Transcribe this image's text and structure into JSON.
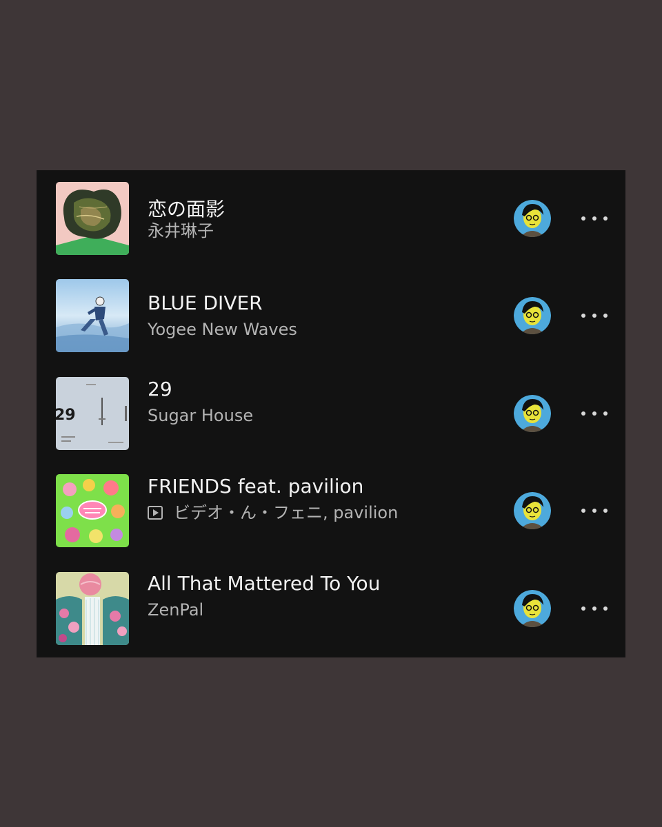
{
  "colors": {
    "background": "#3e3637",
    "panel": "#121212",
    "title": "#f2f2f2",
    "subtitle": "#b3b3b3"
  },
  "tracks": [
    {
      "title": "恋の面影",
      "artist": "永井琳子",
      "is_video": false,
      "cover_icon": "album-art-green-pink",
      "avatar_icon": "cartoon-avatar",
      "more_icon": "more-icon"
    },
    {
      "title": "BLUE DIVER",
      "artist": "Yogee New Waves",
      "is_video": false,
      "cover_icon": "album-art-sky-diver",
      "avatar_icon": "cartoon-avatar",
      "more_icon": "more-icon"
    },
    {
      "title": "29",
      "artist": "Sugar House",
      "is_video": false,
      "cover_icon": "album-art-grey-29",
      "cover_text": "29",
      "avatar_icon": "cartoon-avatar",
      "more_icon": "more-icon"
    },
    {
      "title": "FRIENDS feat. pavilion",
      "artist": "ビデオ・ん・フェニ, pavilion",
      "is_video": true,
      "video_icon": "video-icon",
      "cover_icon": "album-art-green-cartoon",
      "avatar_icon": "cartoon-avatar",
      "more_icon": "more-icon"
    },
    {
      "title": "All That Mattered To You",
      "artist": "ZenPal",
      "is_video": false,
      "cover_icon": "album-art-waterfall",
      "avatar_icon": "cartoon-avatar",
      "more_icon": "more-icon"
    }
  ]
}
